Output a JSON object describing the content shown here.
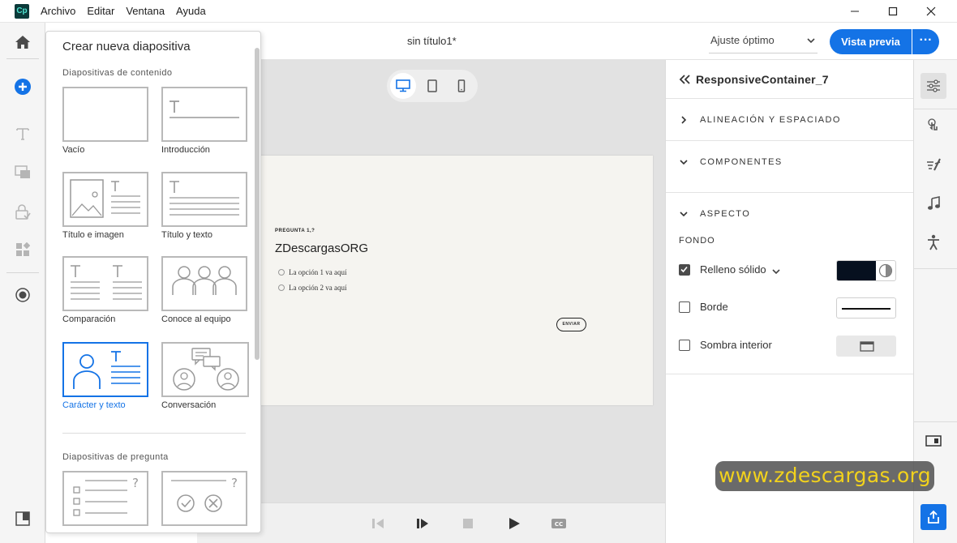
{
  "titlebar": {
    "app_icon": "Cp",
    "menu": [
      "Archivo",
      "Editar",
      "Ventana",
      "Ayuda"
    ],
    "controls": [
      "minimize-icon",
      "maximize-icon",
      "close-icon"
    ]
  },
  "left_rail": {
    "items": [
      "home-icon",
      "add-slide-icon",
      "text-icon",
      "media-icon",
      "interactions-icon",
      "widgets-icon",
      "record-icon",
      "panel-toggle-icon"
    ]
  },
  "header": {
    "doc_title": "sin título1*",
    "zoom": "Ajuste óptimo",
    "preview_label": "Vista previa",
    "more_label": "···"
  },
  "slide_panel": {
    "title": "Crear nueva diapositiva",
    "content_section": "Diapositivas de contenido",
    "tiles": [
      {
        "label": "Vacío"
      },
      {
        "label": "Introducción"
      },
      {
        "label": "Título e imagen"
      },
      {
        "label": "Título y texto"
      },
      {
        "label": "Comparación"
      },
      {
        "label": "Conoce al equipo"
      },
      {
        "label": "Carácter y texto",
        "selected": true
      },
      {
        "label": "Conversación"
      }
    ],
    "question_section": "Diapositivas de pregunta"
  },
  "canvas": {
    "devices": [
      "desktop-icon",
      "tablet-icon",
      "phone-icon"
    ],
    "active_device": "desktop-icon",
    "slide": {
      "question_small": "PREGUNTA 1,?",
      "question_title": "ZDescargasORG",
      "options": [
        "La opción 1 va aquí",
        "La opción 2 va aquí"
      ],
      "submit": "ENVIAR"
    }
  },
  "playbar": {
    "buttons": [
      "previous-icon",
      "play-pause-icon",
      "stop-icon",
      "play-icon",
      "closed-captions-icon"
    ]
  },
  "props": {
    "title": "ResponsiveContainer_7",
    "sections": [
      {
        "label": "ALINEACIÓN Y ESPACIADO",
        "expanded": false
      },
      {
        "label": "COMPONENTES",
        "expanded": true
      },
      {
        "label": "ASPECTO",
        "expanded": true
      }
    ],
    "fondo_label": "FONDO",
    "rows": [
      {
        "label": "Relleno sólido",
        "checked": true
      },
      {
        "label": "Borde",
        "checked": false
      },
      {
        "label": "Sombra interior",
        "checked": false
      }
    ],
    "fill_color": "#06101f"
  },
  "right_rail": {
    "items": [
      "properties-icon",
      "interactions-icon",
      "animations-icon",
      "audio-icon",
      "accessibility-icon",
      "timeline-icon",
      "share-icon"
    ]
  },
  "colors": {
    "accent": "#1473e6",
    "watermark_text": "#f2d21c"
  },
  "watermark": "www.zdescargas.org"
}
